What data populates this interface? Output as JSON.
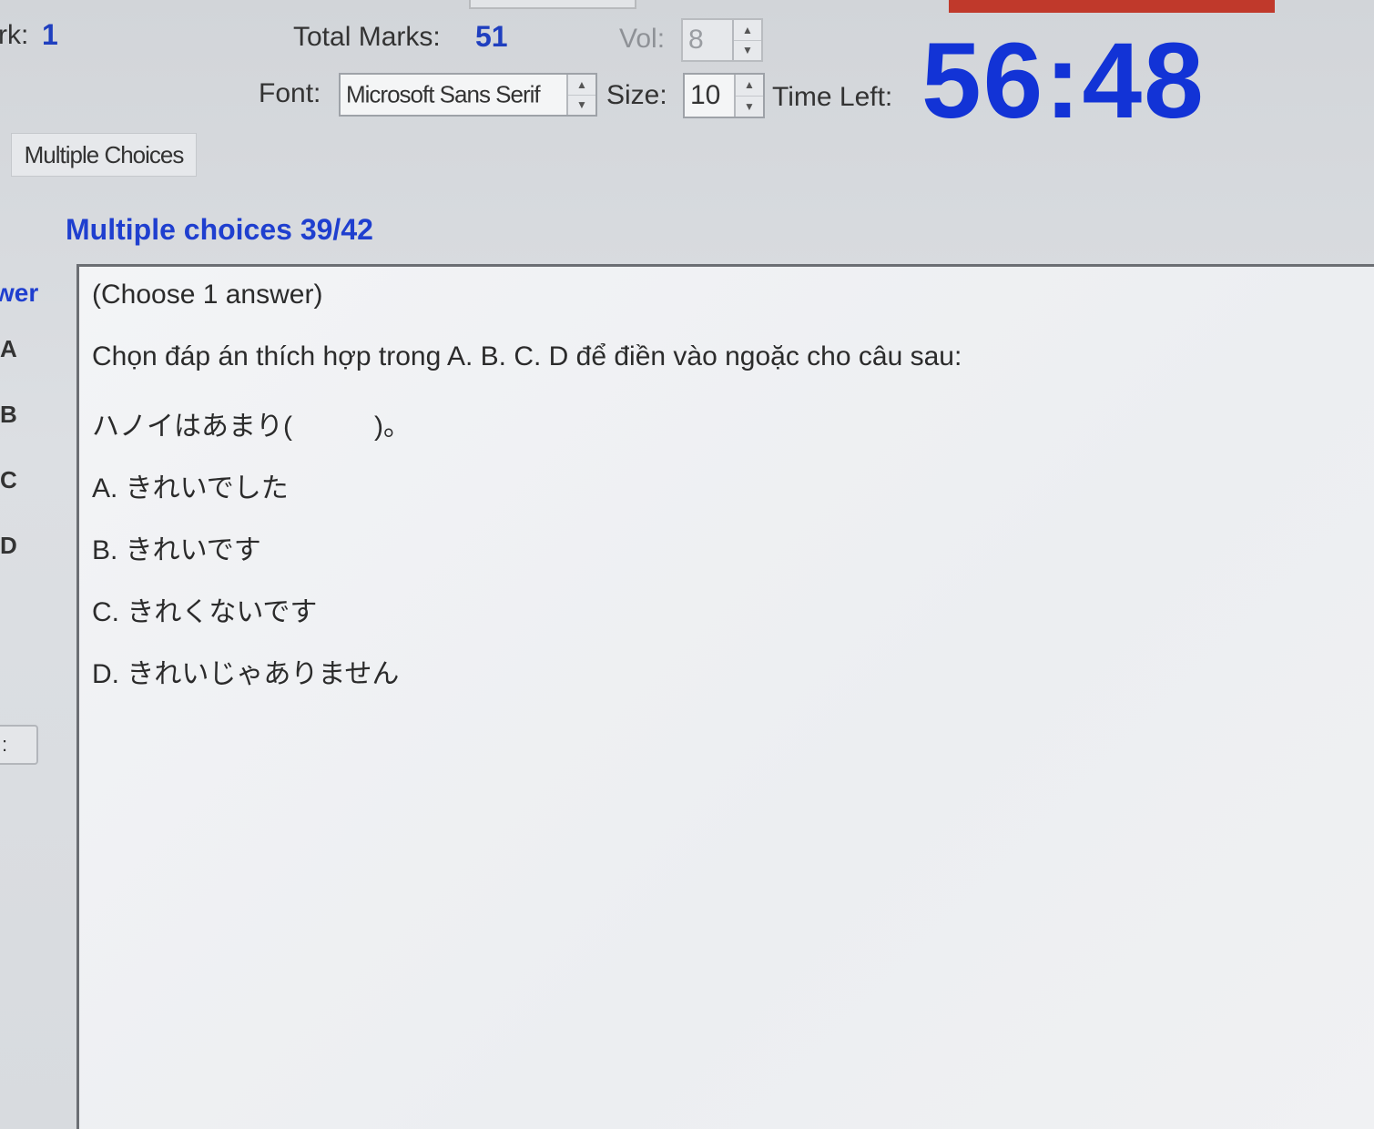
{
  "header": {
    "mark_label": "rk:",
    "mark_value": "1",
    "total_marks_label": "Total Marks:",
    "total_marks_value": "51",
    "vol_label": "Vol:",
    "vol_value": "8",
    "font_label": "Font:",
    "font_value": "Microsoft Sans Serif",
    "size_label": "Size:",
    "size_value": "10",
    "time_left_label": "Time Left:",
    "time_left_value": "56:48"
  },
  "tab": {
    "label": "Multiple Choices"
  },
  "section": {
    "title": "Multiple choices 39/42"
  },
  "answer_sidebar": {
    "header": "wer",
    "options": [
      "A",
      "B",
      "C",
      "D"
    ],
    "button_label": ":"
  },
  "question": {
    "instruction": "(Choose 1 answer)",
    "prompt": "Chọn đáp án thích hợp trong A. B. C. D để điền vào ngoặc cho câu sau:",
    "sentence": "ハノイはあまり(　　　)。",
    "options": [
      "A. きれいでした",
      "B. きれいです",
      "C. きれくないです",
      "D. きれいじゃありません"
    ]
  },
  "colors": {
    "accent_blue": "#1f3fcf",
    "timer_blue": "#1233d6",
    "top_bar_red": "#c0392b"
  }
}
